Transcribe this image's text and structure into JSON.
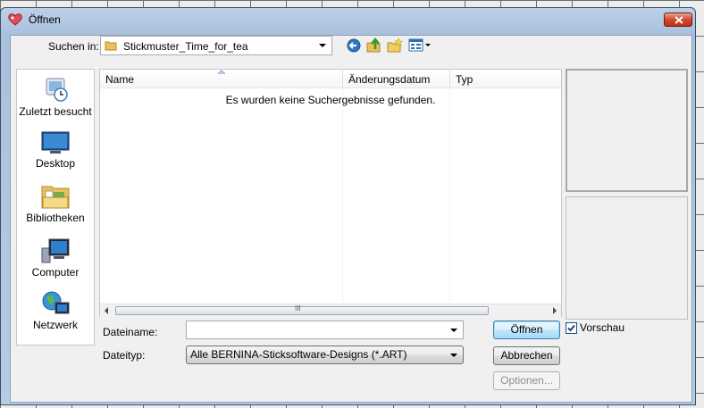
{
  "window": {
    "title": "Öffnen",
    "close_icon": "close-icon"
  },
  "lookin": {
    "label": "Suchen in:",
    "value": "Stickmuster_Time_for_tea",
    "icons": [
      "back-icon",
      "up-folder-icon",
      "new-folder-icon",
      "view-menu-icon"
    ]
  },
  "places": [
    {
      "label": "Zuletzt besucht",
      "icon": "recent-places-icon"
    },
    {
      "label": "Desktop",
      "icon": "desktop-icon"
    },
    {
      "label": "Bibliotheken",
      "icon": "libraries-icon"
    },
    {
      "label": "Computer",
      "icon": "computer-icon"
    },
    {
      "label": "Netzwerk",
      "icon": "network-icon"
    }
  ],
  "filelist": {
    "columns": [
      "Name",
      "Änderungsdatum",
      "Typ"
    ],
    "empty_message": "Es wurden keine Suchergebnisse gefunden.",
    "scroll_grip": "III"
  },
  "filename": {
    "label": "Dateiname:",
    "value": ""
  },
  "filetype": {
    "label": "Dateityp:",
    "value": "Alle BERNINA-Sticksoftware-Designs (*.ART)"
  },
  "buttons": {
    "open": "Öffnen",
    "cancel": "Abbrechen",
    "options": "Optionen..."
  },
  "preview": {
    "label": "Vorschau",
    "checked": true
  }
}
